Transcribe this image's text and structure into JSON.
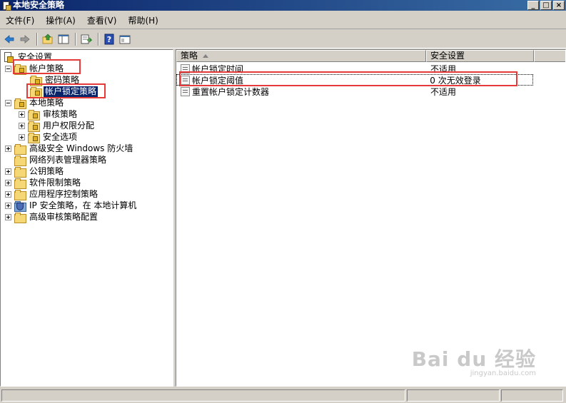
{
  "window": {
    "title": "本地安全策略",
    "controls": [
      "_",
      "□",
      "×"
    ]
  },
  "menu": [
    {
      "label": "文件(F)"
    },
    {
      "label": "操作(A)"
    },
    {
      "label": "查看(V)"
    },
    {
      "label": "帮助(H)"
    }
  ],
  "toolbar": {
    "icons": [
      "back-arrow-icon",
      "forward-arrow-icon",
      "up-folder-icon",
      "show-hide-tree-icon",
      "export-list-icon",
      "help-icon",
      "properties-icon"
    ]
  },
  "tree": {
    "root": "安全设置",
    "items": [
      {
        "label": "帐户策略",
        "level": 1,
        "expander": "minus",
        "icon": "lock-folder"
      },
      {
        "label": "密码策略",
        "level": 2,
        "expander": "none",
        "icon": "lock-folder"
      },
      {
        "label": "帐户锁定策略",
        "level": 2,
        "expander": "none",
        "icon": "lock-folder",
        "selected": true
      },
      {
        "label": "本地策略",
        "level": 1,
        "expander": "minus",
        "icon": "lock-folder"
      },
      {
        "label": "审核策略",
        "level": 2,
        "expander": "plus",
        "icon": "lock-folder"
      },
      {
        "label": "用户权限分配",
        "level": 2,
        "expander": "plus",
        "icon": "lock-folder"
      },
      {
        "label": "安全选项",
        "level": 2,
        "expander": "plus",
        "icon": "lock-folder"
      },
      {
        "label": "高级安全 Windows 防火墙",
        "level": 1,
        "expander": "plus",
        "icon": "folder"
      },
      {
        "label": "网络列表管理器策略",
        "level": 1,
        "expander": "none",
        "icon": "folder"
      },
      {
        "label": "公钥策略",
        "level": 1,
        "expander": "plus",
        "icon": "folder"
      },
      {
        "label": "软件限制策略",
        "level": 1,
        "expander": "plus",
        "icon": "folder"
      },
      {
        "label": "应用程序控制策略",
        "level": 1,
        "expander": "plus",
        "icon": "folder"
      },
      {
        "label": "IP 安全策略，在 本地计算机",
        "level": 1,
        "expander": "plus",
        "icon": "shield"
      },
      {
        "label": "高级审核策略配置",
        "level": 1,
        "expander": "plus",
        "icon": "folder"
      }
    ]
  },
  "list": {
    "columns": [
      "策略",
      "安全设置"
    ],
    "rows": [
      {
        "policy": "帐户锁定时间",
        "setting": "不适用"
      },
      {
        "policy": "帐户锁定阈值",
        "setting": "0 次无效登录",
        "focused": true
      },
      {
        "policy": "重置帐户锁定计数器",
        "setting": "不适用"
      }
    ]
  },
  "watermark": {
    "main": "Bai du 经验",
    "sub": "jingyan.baidu.com"
  },
  "colors": {
    "highlight_box": "#e53a3a",
    "selection": "#0a246a",
    "titlebar": "#0a246a"
  }
}
